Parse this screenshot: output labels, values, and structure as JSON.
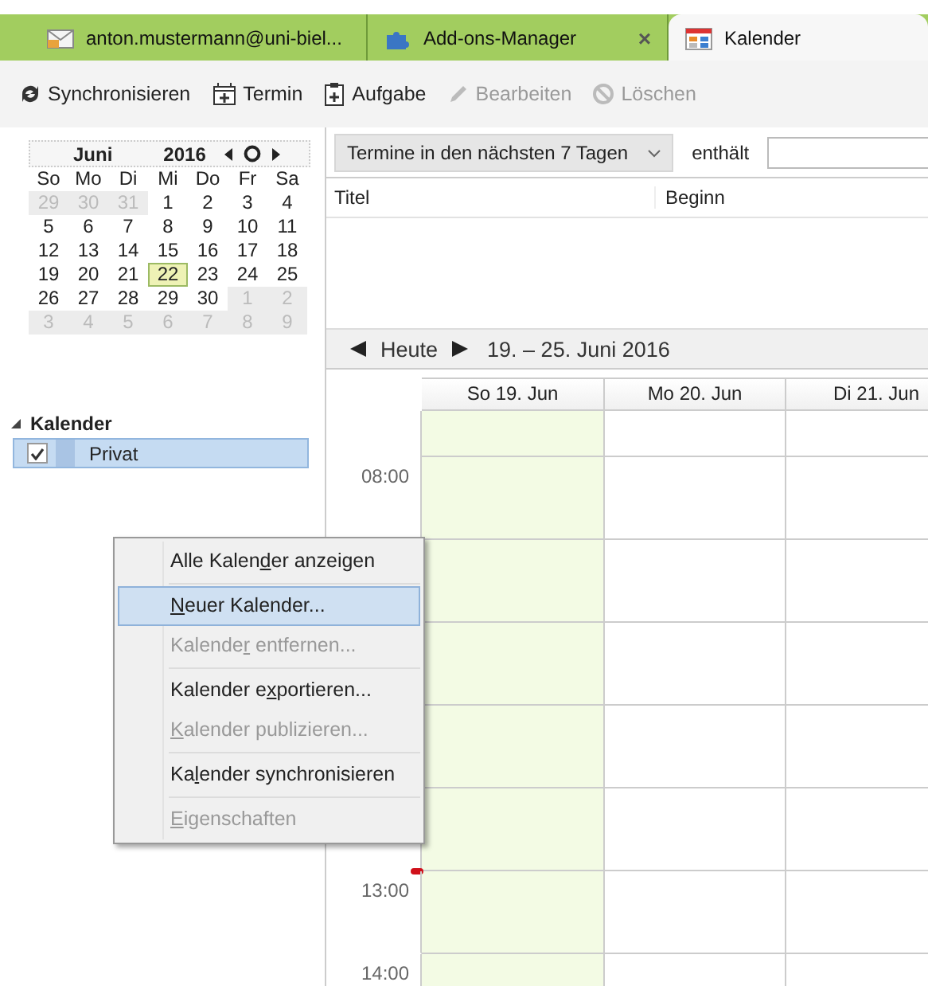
{
  "tabs": [
    {
      "label": "anton.mustermann@uni-biel...",
      "kind": "mail",
      "selected": false
    },
    {
      "label": "Add-ons-Manager",
      "kind": "addons",
      "selected": false,
      "close": "×"
    },
    {
      "label": "Kalender",
      "kind": "calendar",
      "selected": true
    }
  ],
  "toolbar": [
    {
      "label": "Synchronisieren",
      "kind": "sync",
      "disabled": false
    },
    {
      "label": "Termin",
      "kind": "event",
      "disabled": false
    },
    {
      "label": "Aufgabe",
      "kind": "task",
      "disabled": false
    },
    {
      "label": "Bearbeiten",
      "kind": "edit",
      "disabled": true
    },
    {
      "label": "Löschen",
      "kind": "delete",
      "disabled": true
    }
  ],
  "mini_calendar": {
    "month": "Juni",
    "year": "2016",
    "weekdays": [
      "So",
      "Mo",
      "Di",
      "Mi",
      "Do",
      "Fr",
      "Sa"
    ],
    "days": [
      {
        "d": "29",
        "other_month": true,
        "today": false
      },
      {
        "d": "30",
        "other_month": true,
        "today": false
      },
      {
        "d": "31",
        "other_month": true,
        "today": false
      },
      {
        "d": "1",
        "other_month": false,
        "today": false
      },
      {
        "d": "2",
        "other_month": false,
        "today": false
      },
      {
        "d": "3",
        "other_month": false,
        "today": false
      },
      {
        "d": "4",
        "other_month": false,
        "today": false
      },
      {
        "d": "5",
        "other_month": false,
        "today": false
      },
      {
        "d": "6",
        "other_month": false,
        "today": false
      },
      {
        "d": "7",
        "other_month": false,
        "today": false
      },
      {
        "d": "8",
        "other_month": false,
        "today": false
      },
      {
        "d": "9",
        "other_month": false,
        "today": false
      },
      {
        "d": "10",
        "other_month": false,
        "today": false
      },
      {
        "d": "11",
        "other_month": false,
        "today": false
      },
      {
        "d": "12",
        "other_month": false,
        "today": false
      },
      {
        "d": "13",
        "other_month": false,
        "today": false
      },
      {
        "d": "14",
        "other_month": false,
        "today": false
      },
      {
        "d": "15",
        "other_month": false,
        "today": false
      },
      {
        "d": "16",
        "other_month": false,
        "today": false
      },
      {
        "d": "17",
        "other_month": false,
        "today": false
      },
      {
        "d": "18",
        "other_month": false,
        "today": false
      },
      {
        "d": "19",
        "other_month": false,
        "today": false
      },
      {
        "d": "20",
        "other_month": false,
        "today": false
      },
      {
        "d": "21",
        "other_month": false,
        "today": false
      },
      {
        "d": "22",
        "other_month": false,
        "today": true
      },
      {
        "d": "23",
        "other_month": false,
        "today": false
      },
      {
        "d": "24",
        "other_month": false,
        "today": false
      },
      {
        "d": "25",
        "other_month": false,
        "today": false
      },
      {
        "d": "26",
        "other_month": false,
        "today": false
      },
      {
        "d": "27",
        "other_month": false,
        "today": false
      },
      {
        "d": "28",
        "other_month": false,
        "today": false
      },
      {
        "d": "29",
        "other_month": false,
        "today": false
      },
      {
        "d": "30",
        "other_month": false,
        "today": false
      },
      {
        "d": "1",
        "other_month": true,
        "today": false
      },
      {
        "d": "2",
        "other_month": true,
        "today": false
      },
      {
        "d": "3",
        "other_month": true,
        "today": false
      },
      {
        "d": "4",
        "other_month": true,
        "today": false
      },
      {
        "d": "5",
        "other_month": true,
        "today": false
      },
      {
        "d": "6",
        "other_month": true,
        "today": false
      },
      {
        "d": "7",
        "other_month": true,
        "today": false
      },
      {
        "d": "8",
        "other_month": true,
        "today": false
      },
      {
        "d": "9",
        "other_month": true,
        "today": false
      }
    ]
  },
  "calendars": {
    "title": "Kalender",
    "expanded": true,
    "items": [
      {
        "name": "Privat",
        "checked": true,
        "selected": true,
        "color": "#a9c4e4"
      }
    ]
  },
  "filter": {
    "range": "Termine in den nächsten 7 Tagen",
    "contains_label": "enthält"
  },
  "list": {
    "columns": [
      "Titel",
      "Beginn"
    ]
  },
  "week": {
    "today_button": "Heute",
    "range": "19. – 25. Juni 2016",
    "days": [
      {
        "label": "So 19. Jun",
        "today": true
      },
      {
        "label": "Mo 20. Jun",
        "today": false
      },
      {
        "label": "Di 21. Jun",
        "today": false
      }
    ],
    "hours": [
      {
        "label": "08:00"
      },
      {
        "label": "13:00"
      },
      {
        "label": "14:00"
      }
    ],
    "now_marker": true
  },
  "context_menu": {
    "groups": [
      [
        {
          "before": "Alle Kalen",
          "key": "d",
          "after": "er anzeigen",
          "disabled": false,
          "selected": false
        }
      ],
      [
        {
          "key": "N",
          "after": "euer Kalender...",
          "disabled": false,
          "selected": true
        },
        {
          "before": "Kalende",
          "key": "r",
          "after": " entfernen...",
          "disabled": true,
          "selected": false
        }
      ],
      [
        {
          "before": "Kalender e",
          "key": "x",
          "after": "portieren...",
          "disabled": false,
          "selected": false
        },
        {
          "key": "K",
          "after": "alender publizieren...",
          "disabled": true,
          "selected": false
        }
      ],
      [
        {
          "before": "Ka",
          "key": "l",
          "after": "ender synchronisieren",
          "disabled": false,
          "selected": false
        }
      ],
      [
        {
          "key": "E",
          "after": "igenschaften",
          "disabled": true,
          "selected": false
        }
      ]
    ]
  }
}
